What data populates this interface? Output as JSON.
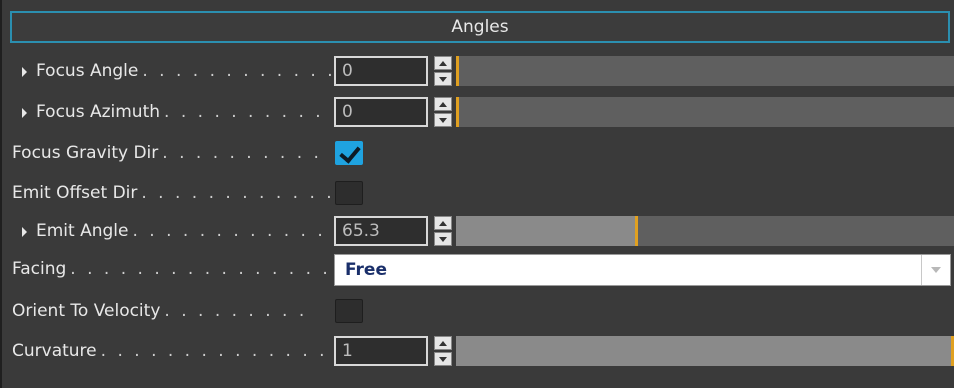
{
  "panel": {
    "title": "Angles"
  },
  "rows": {
    "focus_angle": {
      "label": "Focus Angle",
      "dots": ". . . . . . . . . . . .",
      "value": "0",
      "slider_fraction": 0.0
    },
    "focus_azimuth": {
      "label": "Focus Azimuth",
      "dots": ". . . . . . . . . .",
      "value": "0",
      "slider_fraction": 0.0
    },
    "focus_gravity_dir": {
      "label": "Focus Gravity Dir",
      "dots": ". . . . . . . . . .",
      "checked": true
    },
    "emit_offset_dir": {
      "label": "Emit Offset Dir",
      "dots": ". . . . . . . . . . . .",
      "checked": false
    },
    "emit_angle": {
      "label": "Emit Angle",
      "dots": ". . . . . . . . . . . . .",
      "value": "65.3",
      "slider_fraction": 0.36
    },
    "facing": {
      "label": "Facing",
      "dots": ". . . . . . . . . . . . . . . . .",
      "selected": "Free"
    },
    "orient_to_velocity": {
      "label": "Orient To Velocity",
      "dots": ". . . . . . . . .",
      "checked": false
    },
    "curvature": {
      "label": "Curvature",
      "dots": ". . . . . . . . . . . . . . .",
      "value": "1",
      "slider_fraction": 1.0
    }
  },
  "colors": {
    "accent": "#2b8fb0",
    "checkbox_on": "#1fa3e0",
    "slider_handle": "#e0a020"
  }
}
